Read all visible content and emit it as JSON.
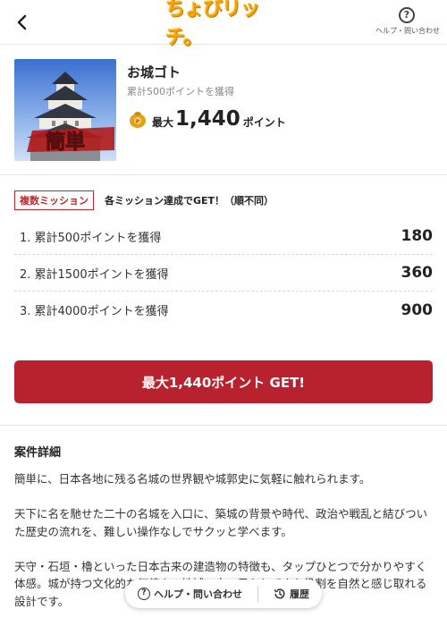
{
  "header": {
    "logo_text": "ちょびリッチ。",
    "help_label": "ヘルプ・問い合わせ",
    "help_glyph": "?"
  },
  "product": {
    "title": "お城ゴト",
    "subtitle": "累計500ポイントを獲得",
    "badge_text": "簡単",
    "points_prefix": "最大",
    "points_value": "1,440",
    "points_unit": "ポイント"
  },
  "missions": {
    "tag": "複数ミッション",
    "note": "各ミッション達成でGET！（順不同）",
    "items": [
      {
        "label": "1. 累計500ポイントを獲得",
        "points": "180"
      },
      {
        "label": "2. 累計1500ポイントを獲得",
        "points": "360"
      },
      {
        "label": "3. 累計4000ポイントを獲得",
        "points": "900"
      }
    ]
  },
  "cta": {
    "label": "最大1,440ポイント GET!"
  },
  "details": {
    "title": "案件詳細",
    "paragraphs": [
      "簡単に、日本各地に残る名城の世界観や城郭史に気軽に触れられます。",
      "天下に名を馳せた二十の名城を入口に、築城の背景や時代、政治や戦乱と結びついた歴史の流れを、難しい操作なしでサクッと学べます。",
      "天守・石垣・櫓といった日本古来の建造物の特徴も、タップひとつで分かりやすく体感。城が持つ文化的な価値や、地域の中で果たしてきた役割を自然と感じ取れる設計です。"
    ]
  },
  "floatbar": {
    "help_label": "ヘルプ・問い合わせ",
    "history_label": "履歴"
  },
  "colors": {
    "accent": "#b8222e",
    "tag": "#c0282d",
    "logo": "#f5a30a"
  },
  "icons": [
    "back-chevron-icon",
    "help-circle-icon",
    "coin-icon",
    "history-clock-icon"
  ]
}
